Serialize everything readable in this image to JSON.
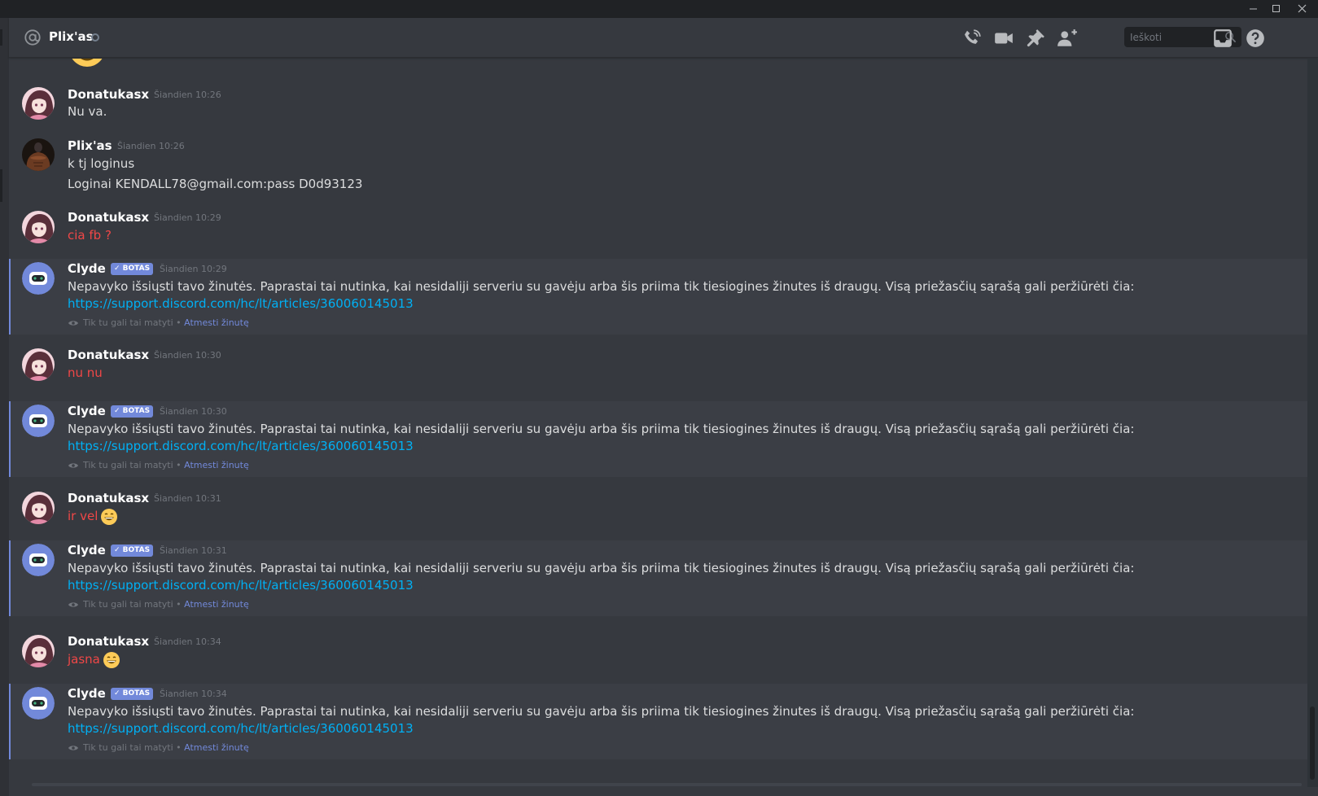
{
  "window": {
    "minimize": "–",
    "maximize": "□",
    "close": "✕"
  },
  "header": {
    "channel_name": "Plix'as",
    "search_placeholder": "Ieškoti",
    "icons": [
      "phone-call-icon",
      "video-icon",
      "pin-icon",
      "add-friend-icon",
      "inbox-icon",
      "help-icon"
    ]
  },
  "ephemeral_note": {
    "text": "Tik tu gali tai matyti",
    "separator": " • ",
    "dismiss": "Atmesti žinutę"
  },
  "bot_badge": "✓ BOTAS",
  "messages": [
    {
      "author": "Donatukasx",
      "time": "Šiandien 10:26",
      "lines": [
        "Nu va."
      ]
    },
    {
      "author": "Plix'as",
      "time": "Šiandien 10:26",
      "lines": [
        "k tj loginus",
        "Loginai KENDALL78@gmail.com:pass D0d93123"
      ]
    },
    {
      "author": "Donatukasx",
      "time": "Šiandien 10:29",
      "lines": [
        "cia fb ?"
      ]
    },
    {
      "author": "Clyde",
      "time": "Šiandien 10:29",
      "text": "Nepavyko išsiųsti tavo žinutės. Paprastai tai nutinka, kai nesidaliji serveriu su gavėju arba šis priima tik tiesiogines žinutes iš draugų. Visą priežasčių sąrašą gali peržiūrėti čia:",
      "link": "https://support.discord.com/hc/lt/articles/360060145013"
    },
    {
      "author": "Donatukasx",
      "time": "Šiandien 10:30",
      "lines": [
        "nu nu"
      ]
    },
    {
      "author": "Clyde",
      "time": "Šiandien 10:30",
      "text": "Nepavyko išsiųsti tavo žinutės. Paprastai tai nutinka, kai nesidaliji serveriu su gavėju arba šis priima tik tiesiogines žinutes iš draugų. Visą priežasčių sąrašą gali peržiūrėti čia:",
      "link": "https://support.discord.com/hc/lt/articles/360060145013"
    },
    {
      "author": "Donatukasx",
      "time": "Šiandien 10:31",
      "lines": [
        "ir vel"
      ]
    },
    {
      "author": "Clyde",
      "time": "Šiandien 10:31",
      "text": "Nepavyko išsiųsti tavo žinutės. Paprastai tai nutinka, kai nesidaliji serveriu su gavėju arba šis priima tik tiesiogines žinutes iš draugų. Visą priežasčių sąrašą gali peržiūrėti čia:",
      "link": "https://support.discord.com/hc/lt/articles/360060145013"
    },
    {
      "author": "Donatukasx",
      "time": "Šiandien 10:34",
      "lines": [
        "jasna"
      ]
    },
    {
      "author": "Clyde",
      "time": "Šiandien 10:34",
      "text": "Nepavyko išsiųsti tavo žinutės. Paprastai tai nutinka, kai nesidaliji serveriu su gavėju arba šis priima tik tiesiogines žinutes iš draugų. Visą priežasčių sąrašą gali peržiūrėti čia:",
      "link": "https://support.discord.com/hc/lt/articles/360060145013"
    }
  ],
  "colors": {
    "background": "#36393f",
    "titlebar": "#202225",
    "bot_highlight": "#3b3e45",
    "accent": "#7289da",
    "link": "#00b0f4",
    "red_text": "#f04747"
  }
}
